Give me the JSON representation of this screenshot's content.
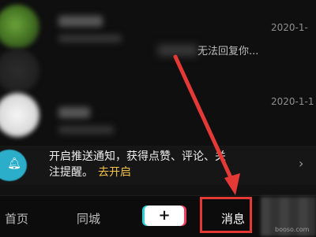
{
  "messages": [
    {
      "timestamp": "2020-1-",
      "preview": ""
    },
    {
      "timestamp": "",
      "preview": "无法回复你..."
    },
    {
      "timestamp": "2020-1-1",
      "preview": ""
    }
  ],
  "notification": {
    "line1": "开启推送通知，获得点赞、评论、关",
    "line2": "注提醒。",
    "cta": "去开启"
  },
  "tabs": {
    "home": "首页",
    "nearby": "同城",
    "add": "+",
    "messages": "消息"
  },
  "watermark": "booso.com",
  "colors": {
    "background": "#121212",
    "accent_cta": "#f4c44a",
    "bell_bg": "#2aaec9",
    "annotation_red": "#e53935"
  }
}
